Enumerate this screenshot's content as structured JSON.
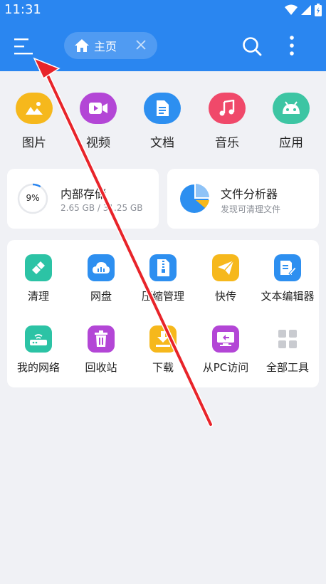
{
  "status_bar": {
    "time": "11:31",
    "icons": [
      "wifi-icon",
      "signal-icon",
      "battery-icon"
    ]
  },
  "header": {
    "menu_icon": "hamburger-menu-icon",
    "tab": {
      "icon": "home-icon",
      "label": "主页",
      "close_icon": "close-icon"
    },
    "search_icon": "search-icon",
    "more_icon": "more-vertical-icon"
  },
  "categories": [
    {
      "label": "图片",
      "icon": "image-icon",
      "color": "#f6b81c"
    },
    {
      "label": "视频",
      "icon": "video-icon",
      "color": "#b346d6"
    },
    {
      "label": "文档",
      "icon": "document-icon",
      "color": "#2d8ff0"
    },
    {
      "label": "音乐",
      "icon": "music-icon",
      "color": "#f0496a"
    },
    {
      "label": "应用",
      "icon": "android-icon",
      "color": "#3dc5a3"
    }
  ],
  "storage": {
    "internal": {
      "title": "内部存储",
      "used": "2.65 GB / 31.25 GB",
      "percent_label": "9%",
      "used_fraction": 0.09
    },
    "analyzer": {
      "title": "文件分析器",
      "subtitle": "发现可清理文件"
    }
  },
  "tools": [
    {
      "label": "清理",
      "icon": "broom-icon",
      "color": "#2cc3a5"
    },
    {
      "label": "网盘",
      "icon": "cloud-icon",
      "color": "#2d8ff0"
    },
    {
      "label": "压缩管理",
      "icon": "zip-icon",
      "color": "#2d8ff0"
    },
    {
      "label": "快传",
      "icon": "paper-plane-icon",
      "color": "#f6b81c"
    },
    {
      "label": "文本编辑器",
      "icon": "text-edit-icon",
      "color": "#2d8ff0"
    },
    {
      "label": "我的网络",
      "icon": "router-icon",
      "color": "#2cc3a5"
    },
    {
      "label": "回收站",
      "icon": "trash-icon",
      "color": "#b346d6"
    },
    {
      "label": "下载",
      "icon": "download-icon",
      "color": "#f6b81c"
    },
    {
      "label": "从PC访问",
      "icon": "pc-icon",
      "color": "#b346d6"
    },
    {
      "label": "全部工具",
      "icon": "grid-icon",
      "color": "#c9cbd0"
    }
  ]
}
